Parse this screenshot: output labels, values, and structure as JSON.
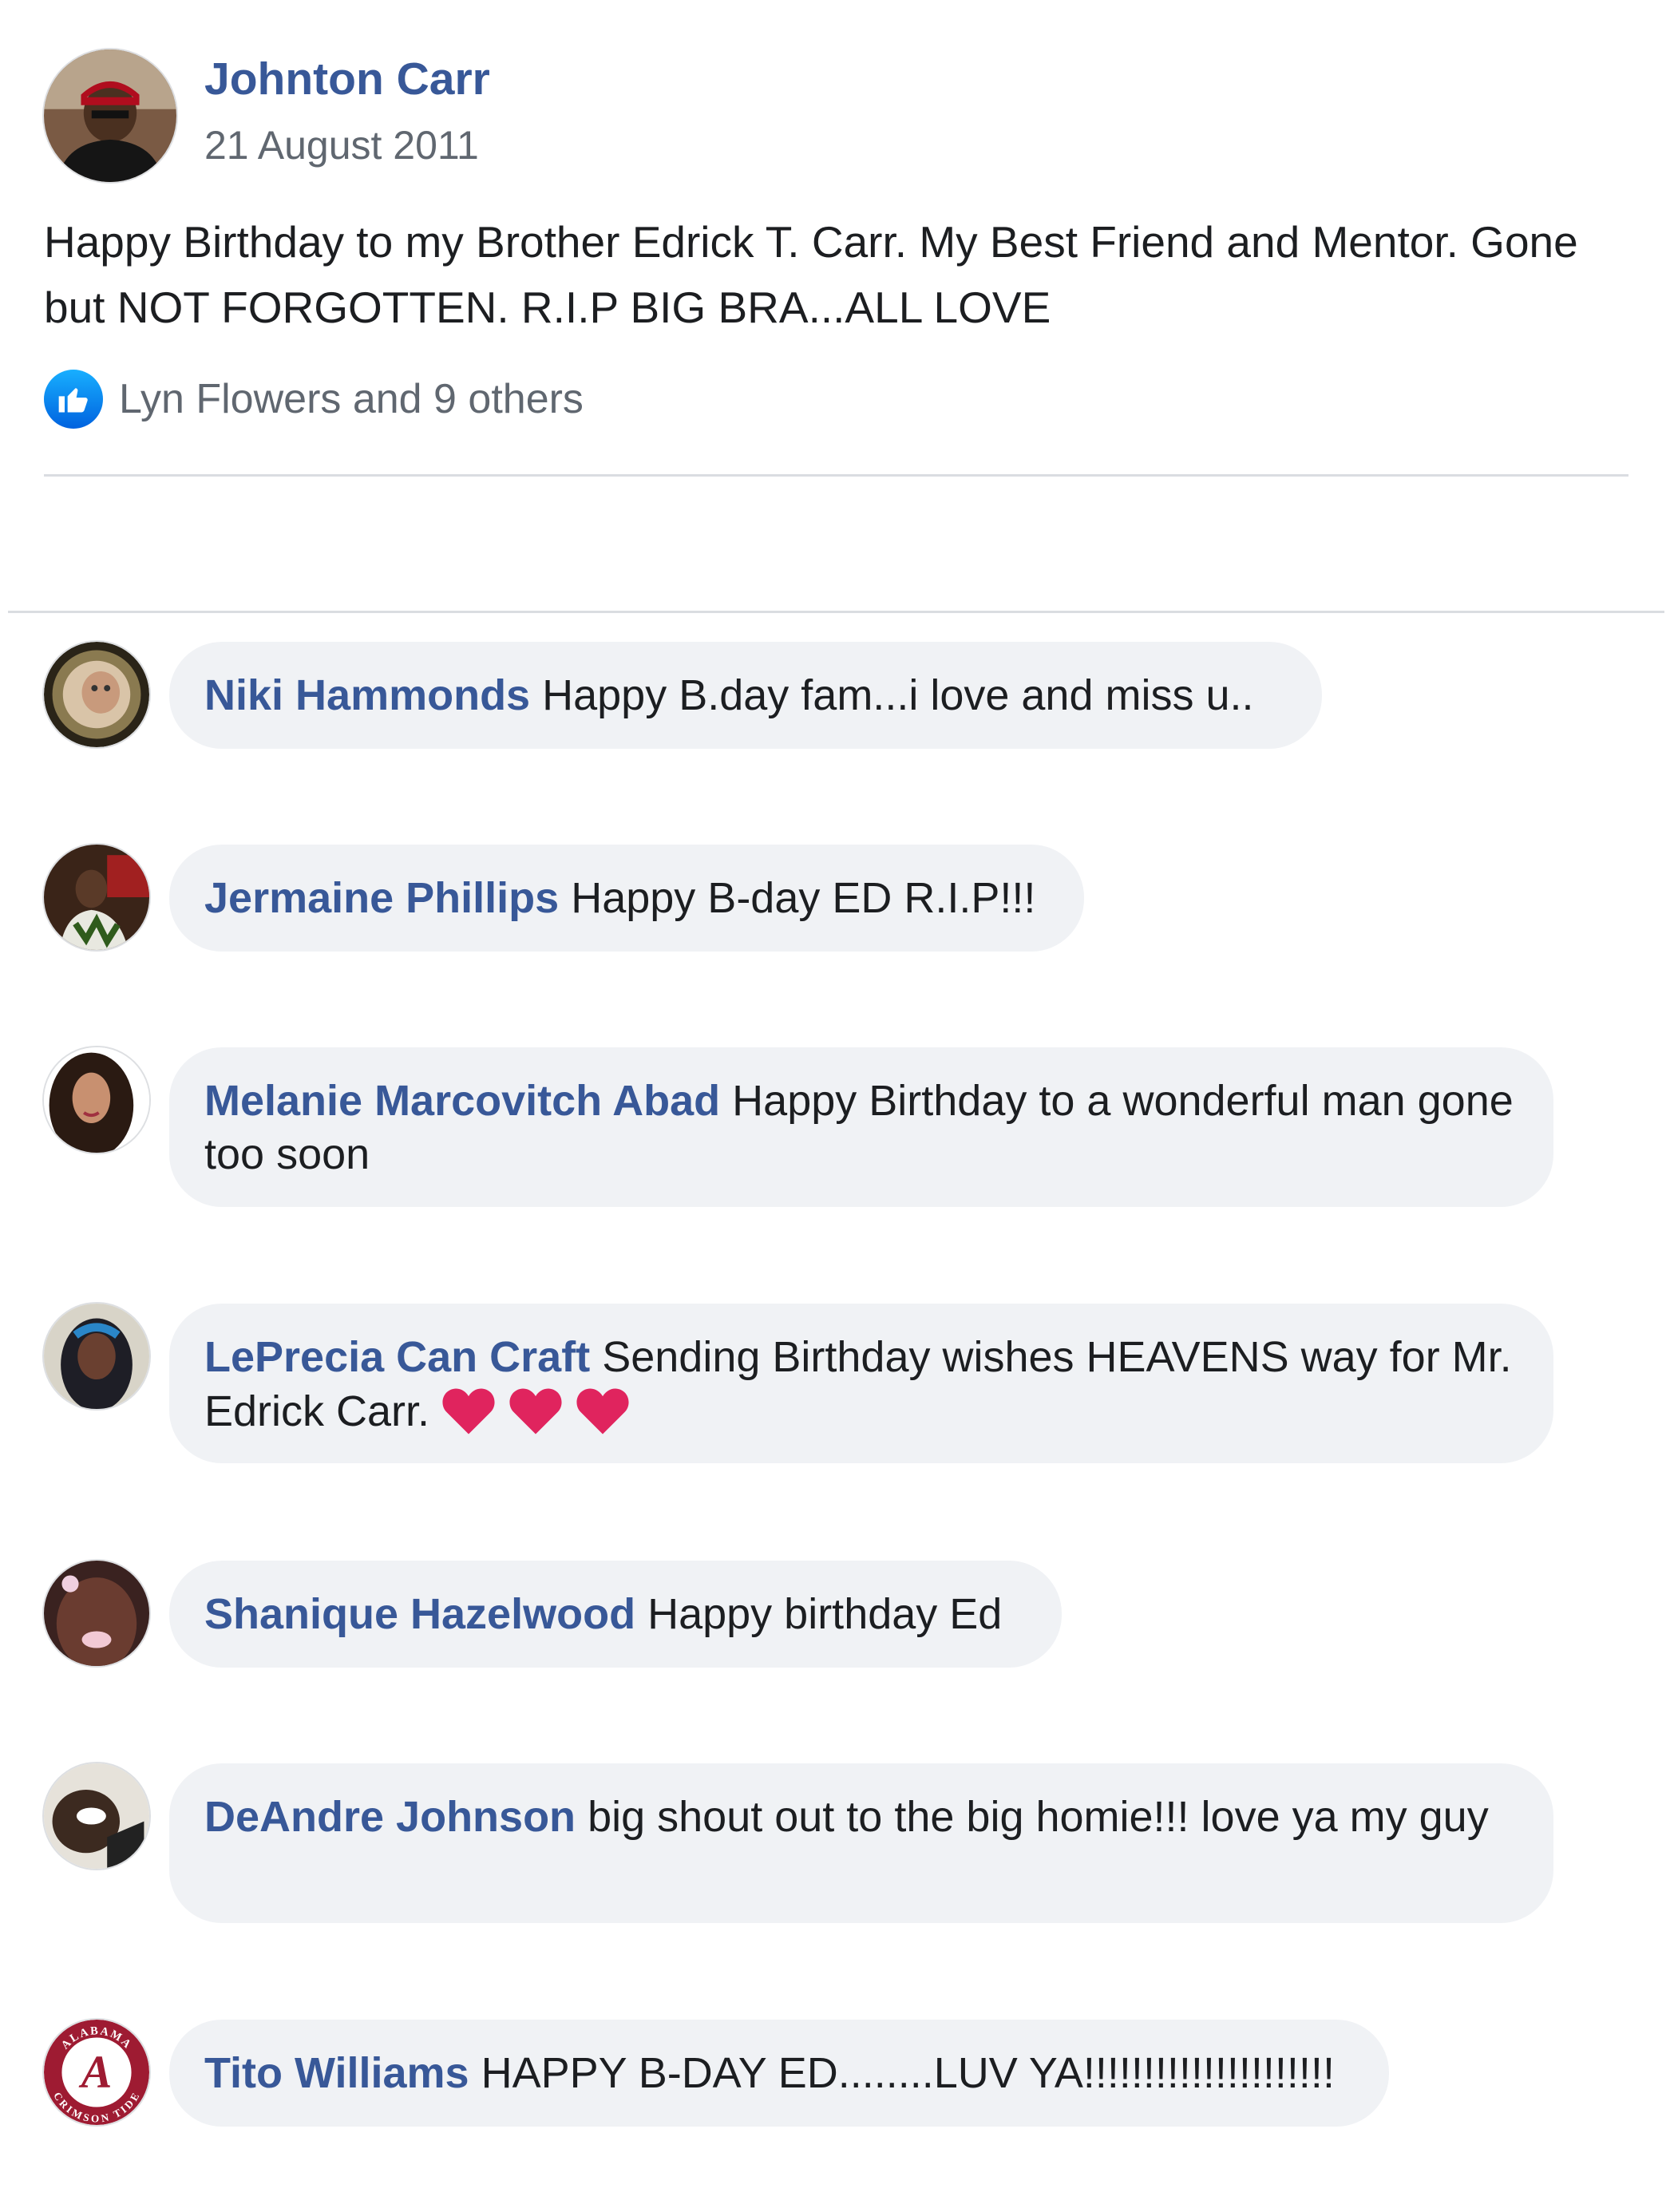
{
  "post": {
    "author": "Johnton Carr",
    "date": "21 August 2011",
    "text": "Happy Birthday to my Brother Edrick T. Carr. My Best Friend and Mentor. Gone but NOT FORGOTTEN. R.I.P BIG BRA...ALL LOVE",
    "reactions": {
      "icon": "like-icon",
      "summary": "Lyn Flowers and 9 others"
    }
  },
  "comments": [
    {
      "name": "Niki Hammonds",
      "text": "Happy B.day fam...i love and miss u.."
    },
    {
      "name": "Jermaine Phillips",
      "text": "Happy B-day ED R.I.P!!!"
    },
    {
      "name": "Melanie Marcovitch Abad",
      "text": "Happy Birthday to a wonderful man gone too soon"
    },
    {
      "name": "LePrecia Can Craft",
      "text": "Sending Birthday wishes HEAVENS way for Mr. Edrick Carr.",
      "emoji": [
        "heart-icon",
        "heart-icon",
        "heart-icon"
      ]
    },
    {
      "name": "Shanique Hazelwood",
      "text": "Happy birthday Ed"
    },
    {
      "name": "DeAndre Johnson",
      "text": "big shout out to the big homie!!! love ya my guy"
    },
    {
      "name": "Tito Williams",
      "text": "HAPPY B-DAY ED........LUV YA!!!!!!!!!!!!!!!!!!!!!"
    }
  ],
  "avatar_logo": {
    "top_text": "ALABAMA",
    "bottom_text": "CRIMSON TIDE",
    "letter": "A"
  },
  "colors": {
    "link": "#385898",
    "bubble": "#f0f2f5",
    "meta": "#606770",
    "like": "#1877f2",
    "heart": "#e0245e",
    "crimson": "#9e1b32"
  }
}
